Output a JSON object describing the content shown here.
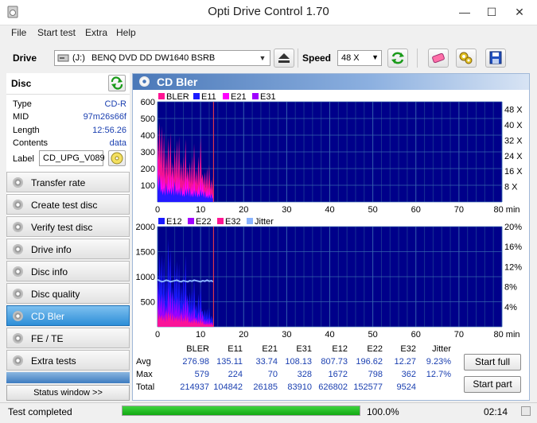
{
  "window": {
    "title": "Opti Drive Control 1.70",
    "minimize": "—",
    "maximize": "☐",
    "close": "✕"
  },
  "menu": [
    "File",
    "Start test",
    "Extra",
    "Help"
  ],
  "toolbar": {
    "drive_label": "Drive",
    "drive_letter": "(J:)",
    "drive_name": "BENQ DVD DD DW1640 BSRB",
    "speed_label": "Speed",
    "speed_value": "48 X"
  },
  "disc": {
    "header": "Disc",
    "type_label": "Type",
    "type": "CD-R",
    "mid_label": "MID",
    "mid": "97m26s66f",
    "length_label": "Length",
    "length": "12:56.26",
    "contents_label": "Contents",
    "contents": "data",
    "label_label": "Label",
    "label": "CD_UPG_V089"
  },
  "nav": [
    {
      "label": "Transfer rate",
      "active": false
    },
    {
      "label": "Create test disc",
      "active": false
    },
    {
      "label": "Verify test disc",
      "active": false
    },
    {
      "label": "Drive info",
      "active": false
    },
    {
      "label": "Disc info",
      "active": false
    },
    {
      "label": "Disc quality",
      "active": false
    },
    {
      "label": "CD Bler",
      "active": true
    },
    {
      "label": "FE / TE",
      "active": false
    },
    {
      "label": "Extra tests",
      "active": false
    }
  ],
  "status_window_button": "Status window >>",
  "panel": {
    "title": "CD Bler"
  },
  "colors": {
    "bler": "#ff1493",
    "e11": "#1a1aff",
    "e21": "#ff00ff",
    "e31": "#a000ff",
    "e12": "#1a1aff",
    "e22": "#a000ff",
    "e32": "#ff1493",
    "jitter": "#8ab4ff",
    "plot_bg": "#00008a",
    "grid": "#2a5a9a",
    "marker": "#ff4040"
  },
  "chart_data": [
    {
      "type": "area",
      "legend": [
        "BLER",
        "E11",
        "E21",
        "E31"
      ],
      "x_ticks": [
        "0",
        "10",
        "20",
        "30",
        "40",
        "50",
        "60",
        "70",
        "80 min"
      ],
      "y_ticks": [
        "600",
        "500",
        "400",
        "300",
        "200",
        "100"
      ],
      "y2_ticks": [
        "48 X",
        "40 X",
        "32 X",
        "24 X",
        "16 X",
        "8 X"
      ],
      "xlim": [
        0,
        80
      ],
      "ylim": [
        0,
        600
      ],
      "marker_x": 13,
      "x": [
        0,
        0.5,
        1,
        1.5,
        2,
        2.5,
        3,
        3.5,
        4,
        4.5,
        5,
        5.5,
        6,
        6.5,
        7,
        7.5,
        8,
        8.5,
        9,
        9.5,
        10,
        10.5,
        11,
        11.5,
        12,
        12.5,
        12.9
      ],
      "series": [
        {
          "name": "BLER",
          "values": [
            560,
            480,
            380,
            300,
            330,
            350,
            320,
            300,
            330,
            310,
            280,
            270,
            250,
            290,
            260,
            240,
            230,
            250,
            220,
            250,
            300,
            210,
            180,
            170,
            160,
            150,
            140
          ]
        },
        {
          "name": "E11",
          "values": [
            230,
            210,
            150,
            130,
            150,
            170,
            140,
            130,
            150,
            140,
            120,
            115,
            110,
            130,
            115,
            105,
            100,
            110,
            95,
            105,
            125,
            90,
            80,
            75,
            70,
            65,
            60
          ]
        },
        {
          "name": "E21",
          "values": [
            30,
            25,
            20,
            18,
            20,
            22,
            19,
            18,
            20,
            19,
            16,
            15,
            14,
            17,
            15,
            14,
            13,
            14,
            12,
            14,
            17,
            12,
            10,
            10,
            9,
            9,
            8
          ]
        },
        {
          "name": "E31",
          "values": [
            140,
            120,
            90,
            80,
            90,
            100,
            85,
            80,
            90,
            85,
            75,
            70,
            65,
            80,
            70,
            62,
            60,
            66,
            56,
            64,
            76,
            54,
            48,
            45,
            42,
            40,
            36
          ]
        }
      ]
    },
    {
      "type": "area",
      "legend": [
        "E12",
        "E22",
        "E32",
        "Jitter"
      ],
      "x_ticks": [
        "0",
        "10",
        "20",
        "30",
        "40",
        "50",
        "60",
        "70",
        "80 min"
      ],
      "y_ticks": [
        "2000",
        "1500",
        "1000",
        "500"
      ],
      "y2_ticks": [
        "20%",
        "16%",
        "12%",
        "8%",
        "4%"
      ],
      "xlim": [
        0,
        80
      ],
      "ylim": [
        0,
        2000
      ],
      "y2lim": [
        0,
        20
      ],
      "marker_x": 13,
      "x": [
        0,
        0.5,
        1,
        1.5,
        2,
        2.5,
        3,
        3.5,
        4,
        4.5,
        5,
        5.5,
        6,
        6.5,
        7,
        7.5,
        8,
        8.5,
        9,
        9.5,
        10,
        10.5,
        11,
        11.5,
        12,
        12.5,
        12.9
      ],
      "series": [
        {
          "name": "E12",
          "values": [
            1400,
            1500,
            1200,
            1000,
            1100,
            1600,
            1200,
            1000,
            1300,
            1100,
            900,
            950,
            1000,
            1100,
            800,
            700,
            650,
            700,
            500,
            600,
            650,
            400,
            350,
            300,
            280,
            250,
            200
          ]
        },
        {
          "name": "E22",
          "values": [
            700,
            750,
            600,
            500,
            550,
            800,
            600,
            500,
            650,
            550,
            450,
            480,
            500,
            550,
            400,
            350,
            320,
            350,
            250,
            300,
            320,
            200,
            175,
            150,
            140,
            125,
            100
          ]
        },
        {
          "name": "E32",
          "values": [
            300,
            320,
            250,
            200,
            230,
            350,
            260,
            210,
            280,
            230,
            190,
            200,
            210,
            230,
            170,
            150,
            140,
            150,
            110,
            130,
            140,
            90,
            80,
            70,
            60,
            55,
            45
          ]
        },
        {
          "name": "Jitter",
          "values": [
            9.4,
            9.2,
            9.0,
            9.1,
            9.3,
            9.2,
            9.0,
            9.1,
            9.2,
            9.3,
            9.1,
            9.0,
            9.2,
            9.1,
            9.0,
            9.2,
            9.1,
            9.3,
            9.2,
            9.1,
            9.0,
            9.2,
            9.1,
            9.3,
            9.1,
            9.2,
            9.0
          ]
        }
      ]
    }
  ],
  "stats": {
    "columns": [
      "BLER",
      "E11",
      "E21",
      "E31",
      "E12",
      "E22",
      "E32",
      "Jitter"
    ],
    "rows": [
      {
        "label": "Avg",
        "values": [
          "276.98",
          "135.11",
          "33.74",
          "108.13",
          "807.73",
          "196.62",
          "12.27",
          "9.23%"
        ]
      },
      {
        "label": "Max",
        "values": [
          "579",
          "224",
          "70",
          "328",
          "1672",
          "798",
          "362",
          "12.7%"
        ]
      },
      {
        "label": "Total",
        "values": [
          "214937",
          "104842",
          "26185",
          "83910",
          "626802",
          "152577",
          "9524",
          ""
        ]
      }
    ]
  },
  "buttons": {
    "start_full": "Start full",
    "start_part": "Start part"
  },
  "status": {
    "text": "Test completed",
    "progress": 100,
    "progress_label": "100.0%",
    "elapsed": "02:14"
  }
}
